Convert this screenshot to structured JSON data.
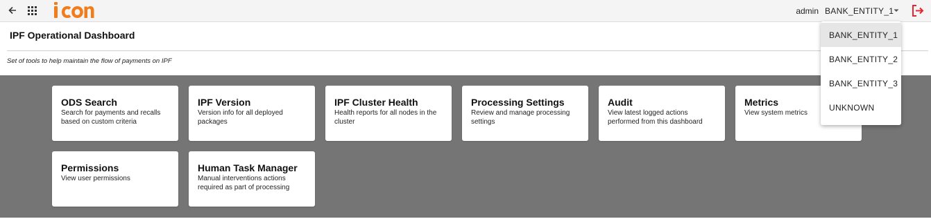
{
  "header": {
    "user": "admin",
    "entity": "BANK_ENTITY_1",
    "brand_colors": {
      "logo_orange": "#f07c1b",
      "logout_red": "#e8242e"
    }
  },
  "page": {
    "title": "IPF Operational Dashboard",
    "subtitle": "Set of tools to help maintain the flow of payments on IPF"
  },
  "cards": [
    {
      "title": "ODS Search",
      "desc": "Search for payments and recalls based on custom criteria"
    },
    {
      "title": "IPF Version",
      "desc": "Version info for all deployed packages"
    },
    {
      "title": "IPF Cluster Health",
      "desc": "Health reports for all nodes in the cluster"
    },
    {
      "title": "Processing Settings",
      "desc": "Review and manage processing settings"
    },
    {
      "title": "Audit",
      "desc": "View latest logged actions performed from this dashboard"
    },
    {
      "title": "Metrics",
      "desc": "View system metrics"
    },
    {
      "title": "Permissions",
      "desc": "View user permissions"
    },
    {
      "title": "Human Task Manager",
      "desc": "Manual interventions actions required as part of processing"
    }
  ],
  "dropdown": {
    "options": [
      "BANK_ENTITY_1",
      "BANK_ENTITY_2",
      "BANK_ENTITY_3",
      "UNKNOWN"
    ],
    "selected": "BANK_ENTITY_1"
  }
}
